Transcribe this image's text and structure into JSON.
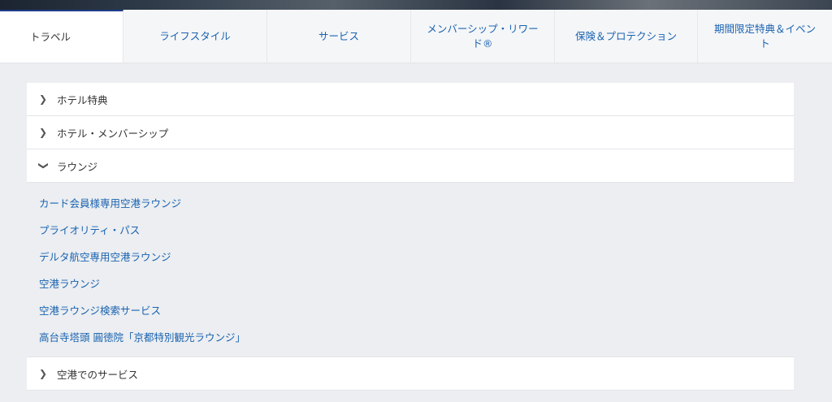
{
  "tabs": [
    {
      "label": "トラベル"
    },
    {
      "label": "ライフスタイル"
    },
    {
      "label": "サービス"
    },
    {
      "label": "メンバーシップ・リワード®"
    },
    {
      "label": "保険＆プロテクション"
    },
    {
      "label": "期間限定特典＆イベント"
    }
  ],
  "accordion": {
    "items": [
      {
        "label": "ホテル特典",
        "icon": "chevron-right-icon"
      },
      {
        "label": "ホテル・メンバーシップ",
        "icon": "chevron-right-icon"
      },
      {
        "label": "ラウンジ",
        "icon": "chevron-down-icon"
      },
      {
        "label": "空港でのサービス",
        "icon": "chevron-right-icon"
      }
    ],
    "lounge_links": [
      {
        "label": "カード会員様専用空港ラウンジ"
      },
      {
        "label": "プライオリティ・パス"
      },
      {
        "label": "デルタ航空専用空港ラウンジ"
      },
      {
        "label": "空港ラウンジ"
      },
      {
        "label": "空港ラウンジ検索サービス"
      },
      {
        "label": "高台寺塔頭 圓徳院「京都特別観光ラウンジ」"
      }
    ]
  },
  "colors": {
    "link": "#1a63b0",
    "active_tab_border": "#1f3c8a",
    "page_bg": "#eceef1"
  }
}
